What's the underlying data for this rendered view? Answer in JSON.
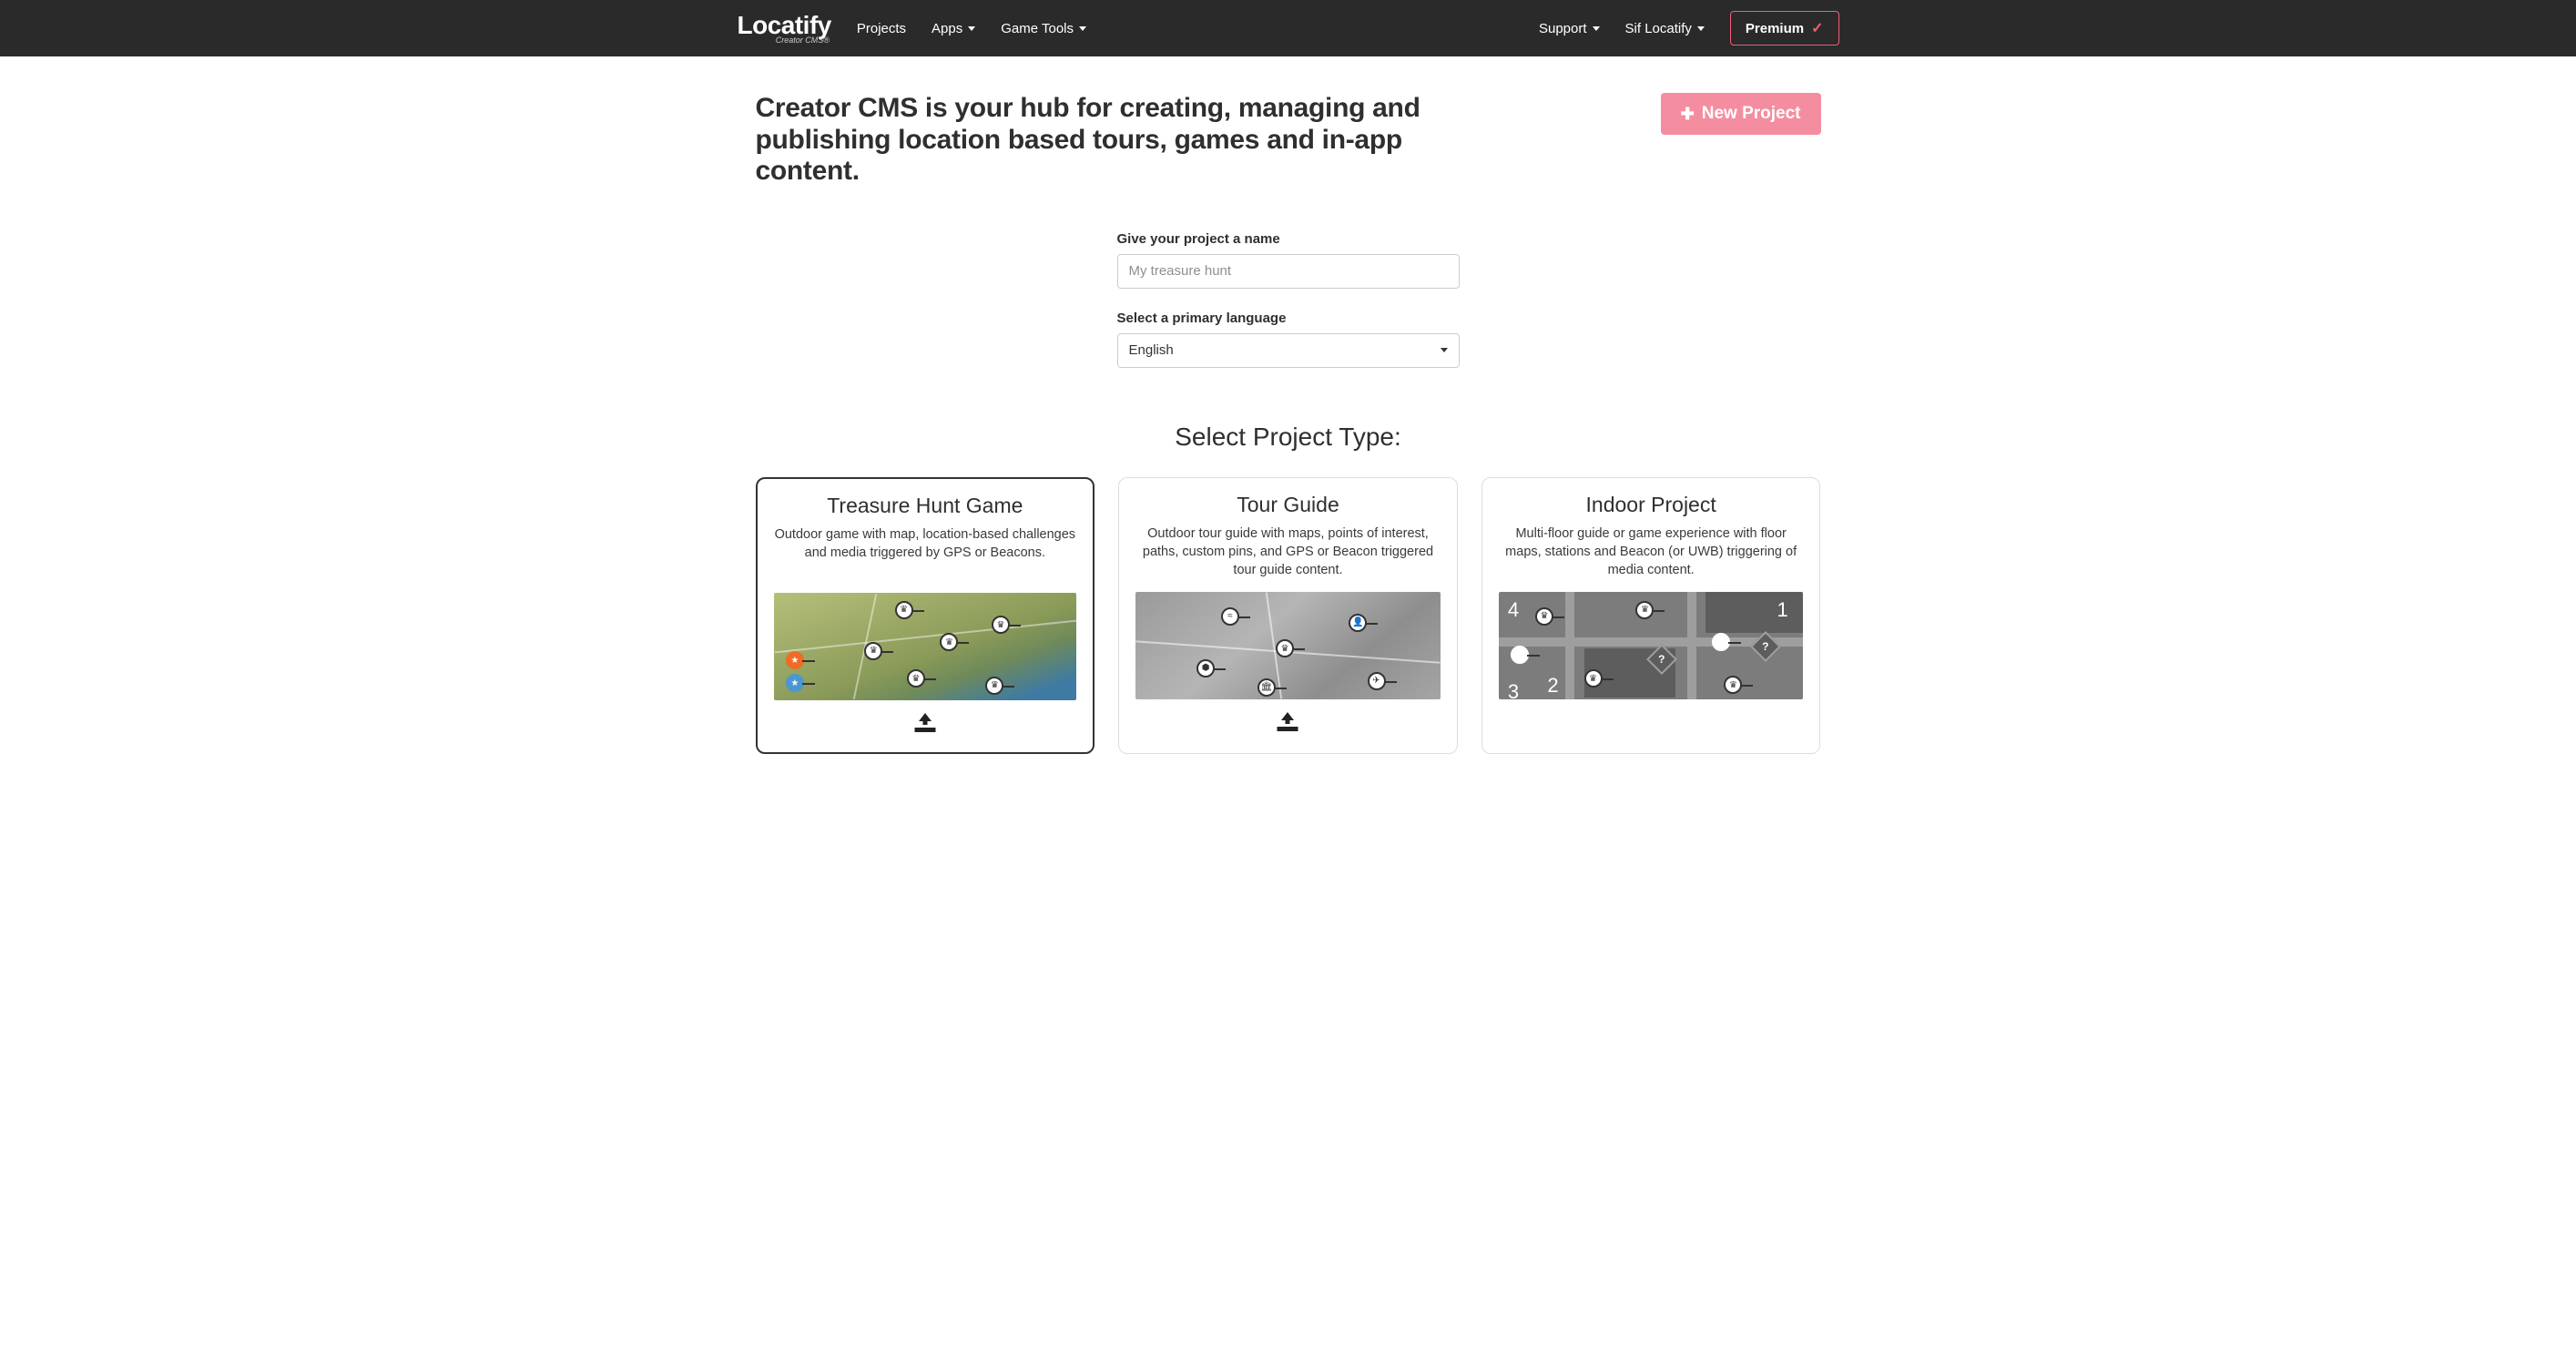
{
  "nav": {
    "logo_main": "Locatify",
    "logo_sub": "Creator CMS®",
    "items_left": [
      "Projects",
      "Apps",
      "Game Tools"
    ],
    "items_left_dropdown": [
      false,
      true,
      true
    ],
    "support": "Support",
    "user": "Sif Locatify",
    "premium": "Premium"
  },
  "hero": {
    "title": "Creator CMS is your hub for creating, managing and publishing location based tours, games and in-app content.",
    "new_project": "New Project"
  },
  "form": {
    "name_label": "Give your project a name",
    "name_placeholder": "My treasure hunt",
    "lang_label": "Select a primary language",
    "lang_value": "English"
  },
  "types": {
    "heading": "Select Project Type:",
    "cards": [
      {
        "title": "Treasure Hunt Game",
        "desc": "Outdoor game with map, location-based challenges and media triggered by GPS or Beacons.",
        "selected": true
      },
      {
        "title": "Tour Guide",
        "desc": "Outdoor tour guide with maps, points of interest, paths, custom pins, and GPS or Beacon triggered tour guide content.",
        "selected": false
      },
      {
        "title": "Indoor Project",
        "desc": "Multi-floor guide or game experience with floor maps, stations and Beacon (or UWB) triggering of media content.",
        "selected": false
      }
    ]
  }
}
